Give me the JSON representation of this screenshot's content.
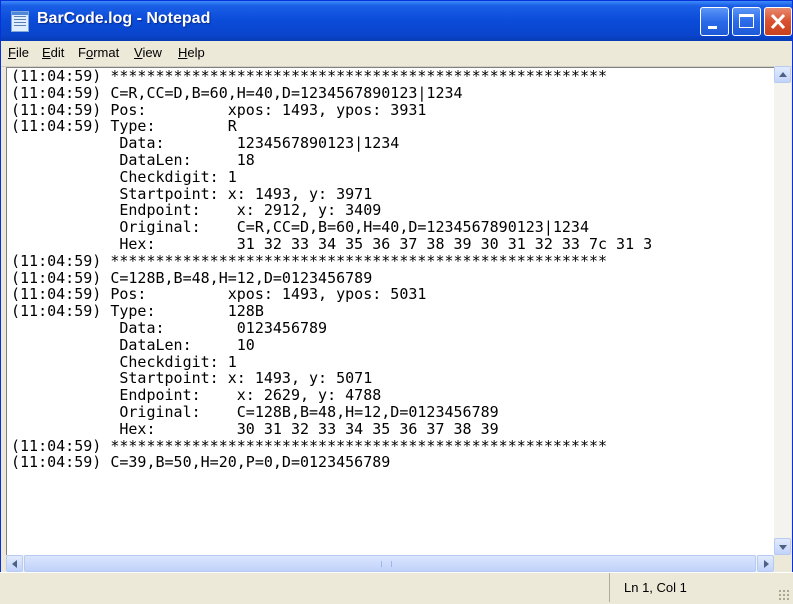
{
  "window": {
    "title": "BarCode.log - Notepad"
  },
  "menu": [
    {
      "underline": "F",
      "rest": "ile"
    },
    {
      "underline": "E",
      "rest": "dit"
    },
    {
      "pre": "F",
      "underline": "o",
      "rest": "rmat"
    },
    {
      "underline": "V",
      "rest": "iew"
    },
    {
      "underline": "H",
      "rest": "elp"
    }
  ],
  "editor": {
    "lines": [
      "(11:04:59) *******************************************************",
      "(11:04:59) C=R,CC=D,B=60,H=40,D=1234567890123|1234",
      "(11:04:59) Pos:         xpos: 1493, ypos: 3931",
      "(11:04:59) Type:        R",
      "            Data:        1234567890123|1234",
      "            DataLen:     18",
      "            Checkdigit: 1",
      "            Startpoint: x: 1493, y: 3971",
      "            Endpoint:    x: 2912, y: 3409",
      "            Original:    C=R,CC=D,B=60,H=40,D=1234567890123|1234",
      "            Hex:         31 32 33 34 35 36 37 38 39 30 31 32 33 7c 31 3",
      "(11:04:59) *******************************************************",
      "(11:04:59) C=128B,B=48,H=12,D=0123456789",
      "(11:04:59) Pos:         xpos: 1493, ypos: 5031",
      "(11:04:59) Type:        128B",
      "            Data:        0123456789",
      "            DataLen:     10",
      "            Checkdigit: 1",
      "            Startpoint: x: 1493, y: 5071",
      "            Endpoint:    x: 2629, y: 4788",
      "            Original:    C=128B,B=48,H=12,D=0123456789",
      "            Hex:         30 31 32 33 34 35 36 37 38 39",
      "(11:04:59) *******************************************************",
      "(11:04:59) C=39,B=50,H=20,P=0,D=0123456789"
    ]
  },
  "status": {
    "position": "Ln 1, Col 1"
  },
  "colors": {
    "titlebar": "#0a4bd8",
    "close_button": "#d9502e"
  },
  "icons": {
    "app": "notepad-icon",
    "minimize": "minimize-icon",
    "maximize": "maximize-icon",
    "close": "close-icon"
  }
}
